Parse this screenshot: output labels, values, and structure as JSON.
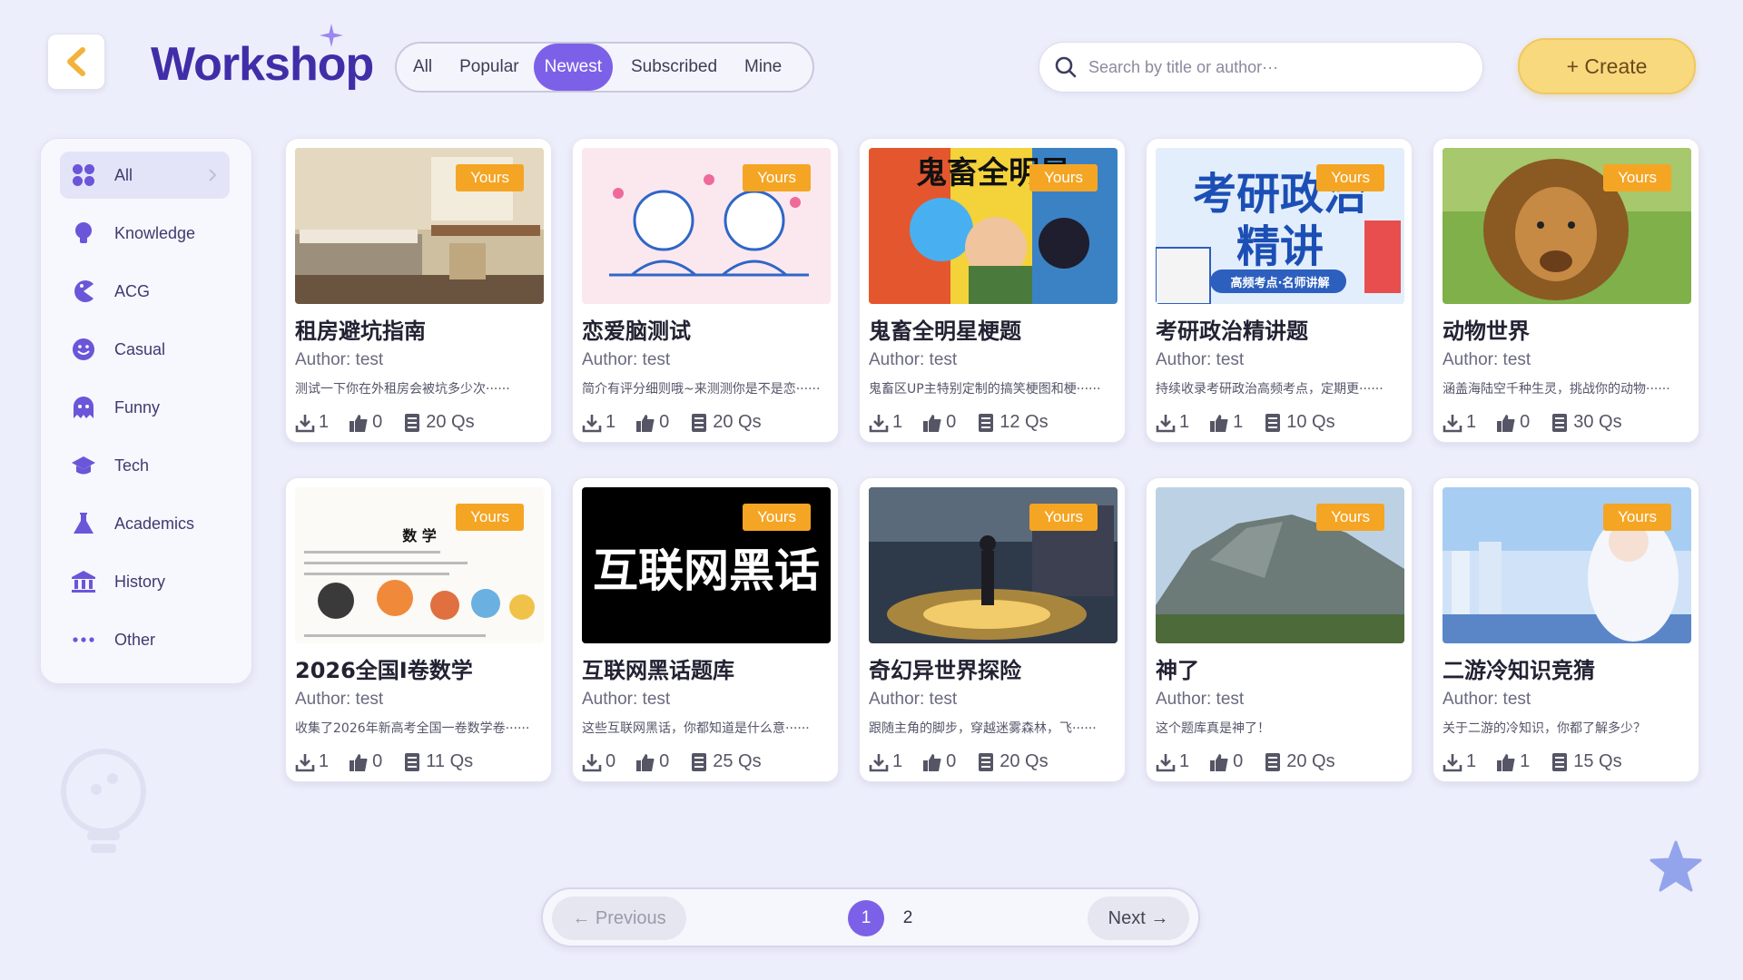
{
  "header": {
    "brand": "Workshop",
    "tabs": [
      "All",
      "Popular",
      "Newest",
      "Subscribed",
      "Mine"
    ],
    "active_tab": "Newest",
    "search_placeholder": "Search by title or author···",
    "create_label": "+ Create"
  },
  "sidebar": {
    "items": [
      {
        "label": "All",
        "icon": "grid-icon",
        "active": true
      },
      {
        "label": "Knowledge",
        "icon": "lightbulb-icon"
      },
      {
        "label": "ACG",
        "icon": "pacman-icon"
      },
      {
        "label": "Casual",
        "icon": "smile-icon"
      },
      {
        "label": "Funny",
        "icon": "ghost-icon"
      },
      {
        "label": "Tech",
        "icon": "graduation-cap-icon"
      },
      {
        "label": "Academics",
        "icon": "flask-icon"
      },
      {
        "label": "History",
        "icon": "museum-icon"
      },
      {
        "label": "Other",
        "icon": "ellipsis-icon"
      }
    ]
  },
  "cards": [
    {
      "badge": "Yours",
      "title": "租房避坑指南",
      "author": "Author: test",
      "desc": "测试一下你在外租房会被坑多少次······",
      "downloads": "1",
      "likes": "0",
      "questions": "20 Qs"
    },
    {
      "badge": "Yours",
      "title": "恋爱脑测试",
      "author": "Author: test",
      "desc": "简介有评分细则哦~来测测你是不是恋······",
      "downloads": "1",
      "likes": "0",
      "questions": "20 Qs"
    },
    {
      "badge": "Yours",
      "title": "鬼畜全明星梗题",
      "author": "Author: test",
      "desc": "鬼畜区UP主特别定制的搞笑梗图和梗······",
      "downloads": "1",
      "likes": "0",
      "questions": "12 Qs",
      "thumb_text": "鬼畜全明星"
    },
    {
      "badge": "Yours",
      "title": "考研政治精讲题",
      "author": "Author: test",
      "desc": "持续收录考研政治高频考点，定期更······",
      "downloads": "1",
      "likes": "1",
      "questions": "10 Qs",
      "thumb_text": "考研政治精讲",
      "thumb_sub": "高频考点·名师讲解"
    },
    {
      "badge": "Yours",
      "title": "动物世界",
      "author": "Author: test",
      "desc": "涵盖海陆空千种生灵，挑战你的动物······",
      "downloads": "1",
      "likes": "0",
      "questions": "30 Qs"
    },
    {
      "badge": "Yours",
      "title": "2026全国I卷数学",
      "author": "Author: test",
      "desc": "收集了2026年新高考全国一卷数学卷······",
      "downloads": "1",
      "likes": "0",
      "questions": "11 Qs",
      "thumb_text": "数 学"
    },
    {
      "badge": "Yours",
      "title": "互联网黑话题库",
      "author": "Author: test",
      "desc": "这些互联网黑话，你都知道是什么意······",
      "downloads": "0",
      "likes": "0",
      "questions": "25 Qs",
      "thumb_text": "互联网黑话"
    },
    {
      "badge": "Yours",
      "title": "奇幻异世界探险",
      "author": "Author: test",
      "desc": "跟随主角的脚步，穿越迷雾森林，飞······",
      "downloads": "1",
      "likes": "0",
      "questions": "20 Qs"
    },
    {
      "badge": "Yours",
      "title": "神了",
      "author": "Author: test",
      "desc": "这个题库真是神了！",
      "downloads": "1",
      "likes": "0",
      "questions": "20 Qs"
    },
    {
      "badge": "Yours",
      "title": "二游冷知识竞猜",
      "author": "Author: test",
      "desc": "关于二游的冷知识，你都了解多少？",
      "downloads": "1",
      "likes": "1",
      "questions": "15 Qs"
    }
  ],
  "pagination": {
    "prev_label": "← Previous",
    "next_label": "Next →",
    "pages": [
      "1",
      "2"
    ],
    "current": "1"
  },
  "colors": {
    "accent": "#7c61e8",
    "brand": "#3f2ea8",
    "badge": "#f5a524",
    "create": "#f9d97e",
    "background": "#edeefb"
  }
}
